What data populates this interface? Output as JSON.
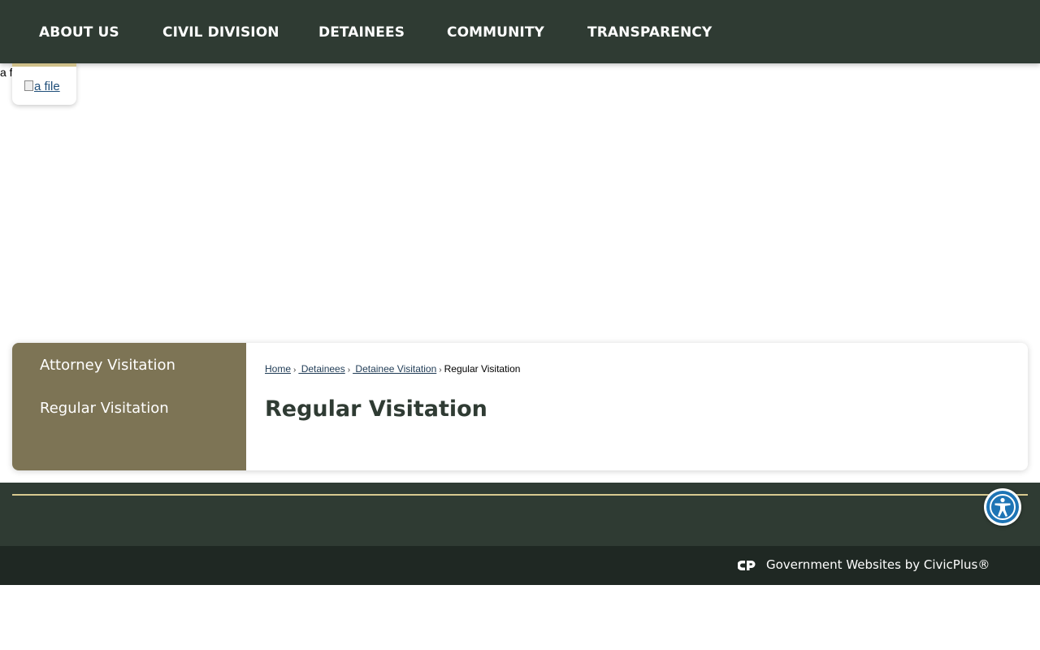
{
  "nav": {
    "items": [
      {
        "label": "ABOUT US"
      },
      {
        "label": "CIVIL DIVISION"
      },
      {
        "label": "DETAINEES"
      },
      {
        "label": "COMMUNITY"
      },
      {
        "label": "TRANSPARENCY"
      }
    ]
  },
  "logo": {
    "stray_alt": "a file",
    "alt_text": "a file"
  },
  "sidebar": {
    "items": [
      {
        "label": "Attorney Visitation"
      },
      {
        "label": "Regular Visitation"
      }
    ]
  },
  "breadcrumb": {
    "items": [
      {
        "label": "Home"
      },
      {
        "label": " Detainees"
      },
      {
        "label": " Detainee Visitation"
      }
    ],
    "current": "Regular Visitation"
  },
  "page": {
    "title": "Regular Visitation"
  },
  "footer": {
    "credit": "Government Websites by CivicPlus®"
  },
  "colors": {
    "nav_bg": "#2f3b33",
    "sidebar_bg": "#7d7455",
    "accent_line": "#d8c98f",
    "accessibility_blue": "#1e74b5"
  },
  "icons": {
    "accessibility": "accessibility-icon",
    "civicplus": "civicplus-logo-icon"
  }
}
